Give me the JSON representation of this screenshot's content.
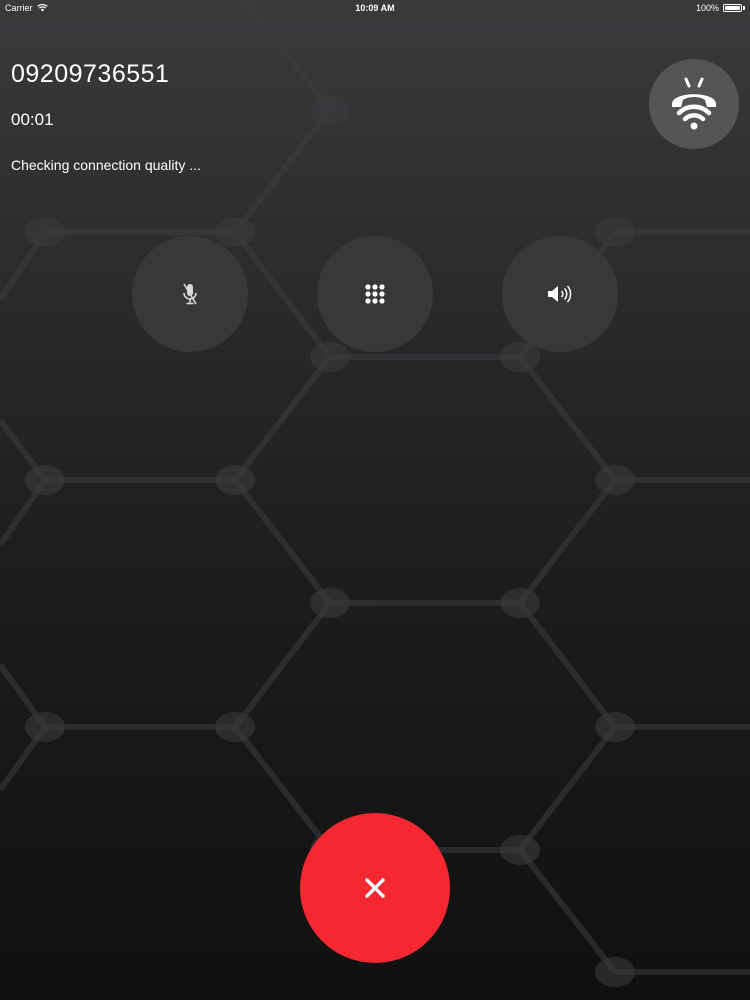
{
  "status_bar": {
    "carrier": "Carrier",
    "wifi_icon": "wifi-icon",
    "time": "10:09 AM",
    "battery": "100%",
    "battery_icon": "battery-icon"
  },
  "call": {
    "number": "09209736551",
    "duration": "00:01",
    "status": "Checking connection quality ..."
  },
  "controls": {
    "connection_quality_icon": "phone-wifi-icon",
    "mute_icon": "microphone-muted-icon",
    "keypad_icon": "keypad-icon",
    "speaker_icon": "speaker-icon",
    "end_call_icon": "close-icon"
  },
  "colors": {
    "end_call": "#f52832",
    "control_bg": "#3a3a3d",
    "quality_bg": "#555558",
    "text": "#ffffff"
  }
}
